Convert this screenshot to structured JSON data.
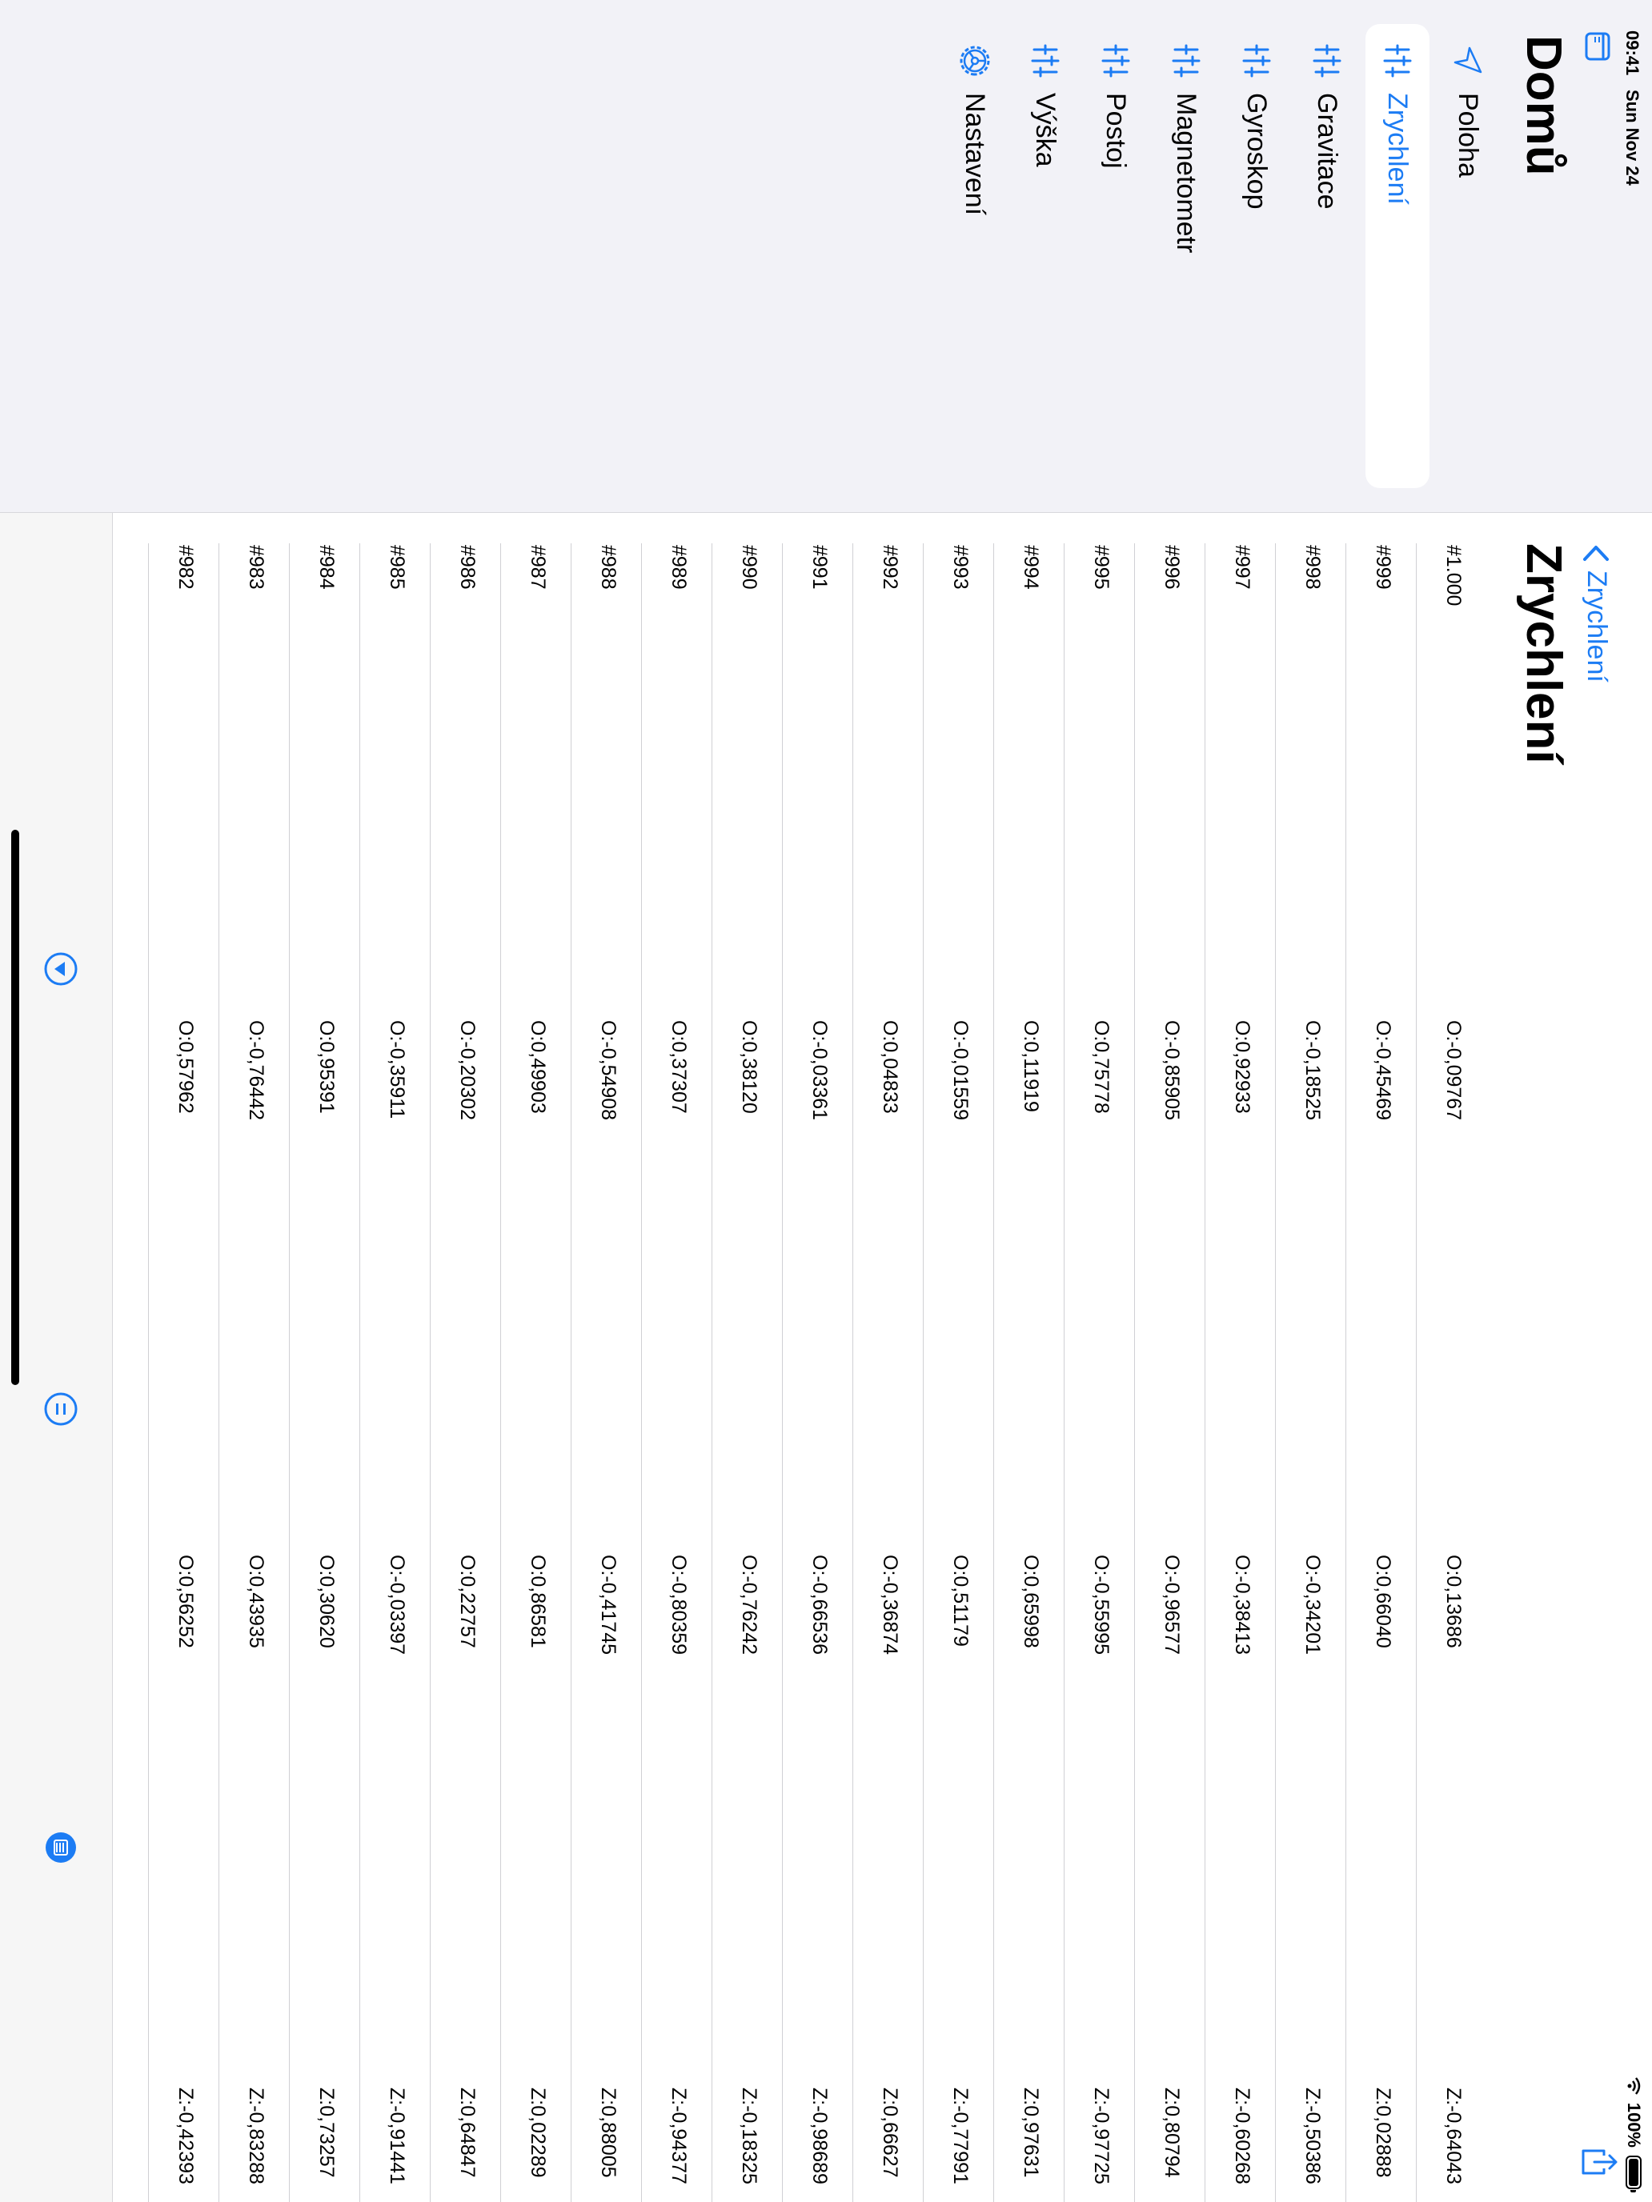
{
  "status_bar": {
    "time": "09:41",
    "date": "Sun Nov 24",
    "battery": "100%"
  },
  "sidebar": {
    "title": "Domů",
    "items": [
      {
        "label": "Poloha",
        "icon": "location-arrow-icon",
        "selected": false
      },
      {
        "label": "Zrychlení",
        "icon": "sensor-bars-icon",
        "selected": true
      },
      {
        "label": "Gravitace",
        "icon": "sensor-bars-icon",
        "selected": false
      },
      {
        "label": "Gyroskop",
        "icon": "sensor-bars-icon",
        "selected": false
      },
      {
        "label": "Magnetometr",
        "icon": "sensor-bars-icon",
        "selected": false
      },
      {
        "label": "Postoj",
        "icon": "sensor-bars-icon",
        "selected": false
      },
      {
        "label": "Výška",
        "icon": "sensor-bars-icon",
        "selected": false
      },
      {
        "label": "Nastavení",
        "icon": "gear-icon",
        "selected": false
      }
    ]
  },
  "main": {
    "back_label": "Zrychlení",
    "title": "Zrychlení",
    "rows": [
      {
        "id": "#1.000",
        "a": "O:-0,09767",
        "b": "O:0,13686",
        "z": "Z:-0,64043"
      },
      {
        "id": "#999",
        "a": "O:-0,45469",
        "b": "O:0,66040",
        "z": "Z:0,02888"
      },
      {
        "id": "#998",
        "a": "O:-0,18525",
        "b": "O:-0,34201",
        "z": "Z:-0,50386"
      },
      {
        "id": "#997",
        "a": "O:0,92933",
        "b": "O:-0,38413",
        "z": "Z:-0,60268"
      },
      {
        "id": "#996",
        "a": "O:-0,85905",
        "b": "O:-0,96577",
        "z": "Z:0,80794"
      },
      {
        "id": "#995",
        "a": "O:0,75778",
        "b": "O:-0,55995",
        "z": "Z:-0,97725"
      },
      {
        "id": "#994",
        "a": "O:0,11919",
        "b": "O:0,65998",
        "z": "Z:0,97631"
      },
      {
        "id": "#993",
        "a": "O:-0,01559",
        "b": "O:0,51179",
        "z": "Z:-0,77991"
      },
      {
        "id": "#992",
        "a": "O:0,04833",
        "b": "O:-0,36874",
        "z": "Z:0,66627"
      },
      {
        "id": "#991",
        "a": "O:-0,03361",
        "b": "O:-0,66536",
        "z": "Z:-0,98689"
      },
      {
        "id": "#990",
        "a": "O:0,38120",
        "b": "O:-0,76242",
        "z": "Z:-0,18325"
      },
      {
        "id": "#989",
        "a": "O:0,37307",
        "b": "O:-0,80359",
        "z": "Z:-0,94377"
      },
      {
        "id": "#988",
        "a": "O:-0,54908",
        "b": "O:-0,41745",
        "z": "Z:0,88005"
      },
      {
        "id": "#987",
        "a": "O:0,49903",
        "b": "O:0,86581",
        "z": "Z:0,02289"
      },
      {
        "id": "#986",
        "a": "O:-0,20302",
        "b": "O:0,22757",
        "z": "Z:0,64847"
      },
      {
        "id": "#985",
        "a": "O:-0,35911",
        "b": "O:-0,03397",
        "z": "Z:-0,91441"
      },
      {
        "id": "#984",
        "a": "O:0,95391",
        "b": "O:0,30620",
        "z": "Z:0,73257"
      },
      {
        "id": "#983",
        "a": "O:-0,76442",
        "b": "O:0,43935",
        "z": "Z:-0,83288"
      },
      {
        "id": "#982",
        "a": "O:0,57962",
        "b": "O:0,56252",
        "z": "Z:-0,42393"
      }
    ]
  },
  "toolbar": {
    "buttons": [
      {
        "icon": "download-circle-icon"
      },
      {
        "icon": "pause-circle-icon"
      },
      {
        "icon": "list-circle-icon"
      }
    ]
  },
  "colors": {
    "accent": "#1c7cf4",
    "background": "#f2f2f7"
  }
}
